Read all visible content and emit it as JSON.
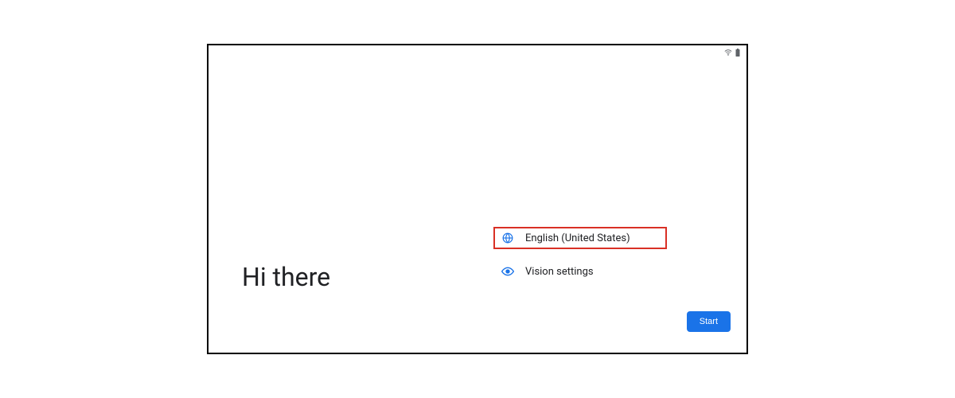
{
  "status": {
    "wifi": "wifi-outline",
    "battery": "battery-full"
  },
  "greeting": "Hi there",
  "options": {
    "language": {
      "label": "English (United States)",
      "icon": "globe",
      "highlighted": true
    },
    "vision": {
      "label": "Vision settings",
      "icon": "eye",
      "highlighted": false
    }
  },
  "start_button": "Start",
  "colors": {
    "accent": "#1a73e8",
    "highlight_border": "#d93025",
    "text": "#202124"
  }
}
